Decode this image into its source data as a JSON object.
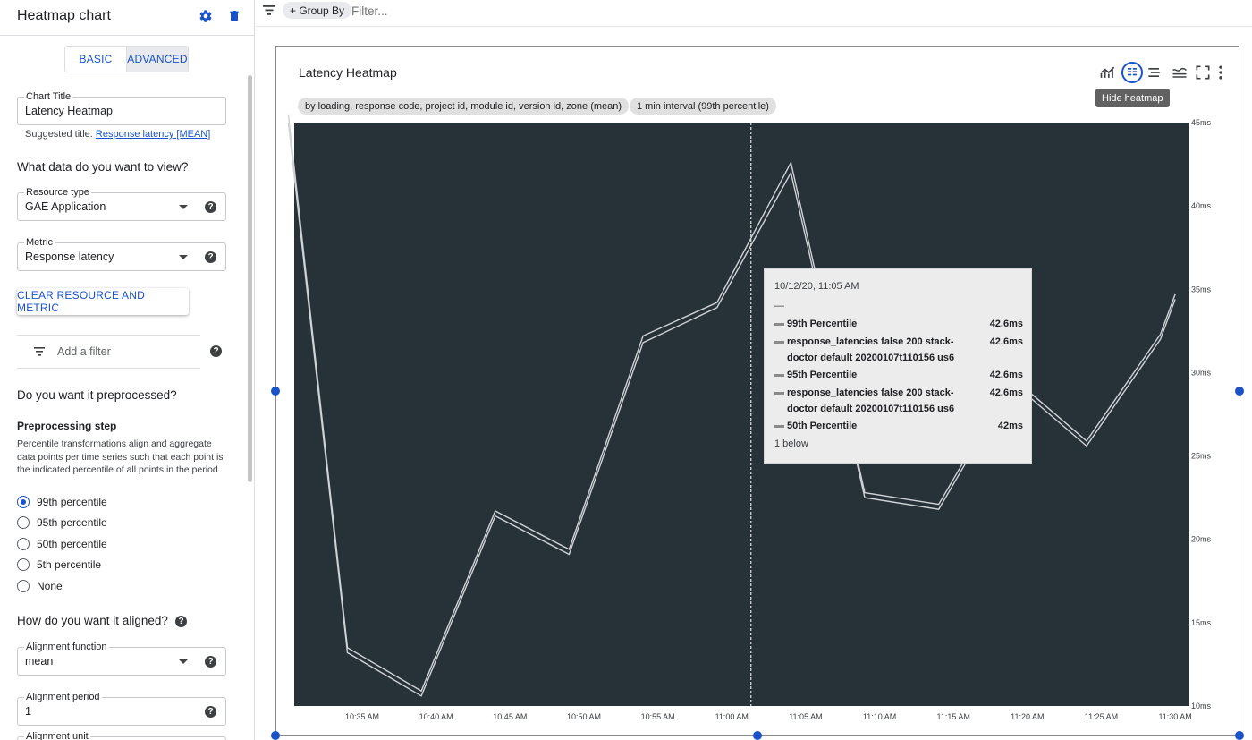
{
  "panel": {
    "title": "Heatmap chart",
    "modes": {
      "basic": "BASIC",
      "advanced": "ADVANCED",
      "active": "advanced"
    },
    "chart_title": {
      "label": "Chart Title",
      "value": "Latency Heatmap"
    },
    "suggested_prefix": "Suggested title:",
    "suggested_link": "Response latency [MEAN]",
    "data_heading": "What data do you want to view?",
    "resource_type": {
      "label": "Resource type",
      "value": "GAE Application"
    },
    "metric": {
      "label": "Metric",
      "value": "Response latency"
    },
    "clear_button": "CLEAR RESOURCE AND METRIC",
    "filter_placeholder": "Add a filter",
    "preprocess_heading": "Do you want it preprocessed?",
    "preprocess_step": "Preprocessing step",
    "preprocess_desc": "Percentile transformations align and aggregate data points per time series such that each point is the indicated percentile of all points in the period",
    "percentiles": [
      "99th percentile",
      "95th percentile",
      "50th percentile",
      "5th percentile",
      "None"
    ],
    "percentile_selected": "99th percentile",
    "align_heading": "How do you want it aligned?",
    "alignment_function": {
      "label": "Alignment function",
      "value": "mean"
    },
    "alignment_period": {
      "label": "Alignment period",
      "value": "1"
    },
    "alignment_unit_label": "Alignment unit"
  },
  "topbar": {
    "group_by": "+ Group By",
    "filter_placeholder": "Filter..."
  },
  "card": {
    "title": "Latency Heatmap",
    "hide_heatmap_tooltip": "Hide heatmap",
    "chips": [
      "by loading, response code, project id, module id, version id, zone (mean)",
      "1 min interval (99th percentile)"
    ],
    "icons": [
      "line-chart-icon",
      "heatmap-toggle-icon",
      "legend-icon",
      "compare-icon",
      "fullscreen-icon",
      "more-vert-icon"
    ]
  },
  "tooltip": {
    "date": "10/12/20, 11:05 AM",
    "dash": "—",
    "rows": [
      {
        "name": "99th Percentile",
        "value": "42.6ms"
      },
      {
        "name": "response_latencies false 200 stack-doctor default 20200107t110156 us6",
        "value": "42.6ms"
      },
      {
        "name": "95th Percentile",
        "value": "42.6ms"
      },
      {
        "name": "response_latencies false 200 stack-doctor default 20200107t110156 us6",
        "value": "42.6ms"
      },
      {
        "name": "50th Percentile",
        "value": "42ms"
      }
    ],
    "below": "1 below"
  },
  "colors": {
    "accent": "#1a53c9",
    "plot_bg": "#263238",
    "line": "#d0d2d6"
  },
  "chart_data": {
    "type": "line",
    "title": "Latency Heatmap",
    "x_ticks": [
      "10:35 AM",
      "10:40 AM",
      "10:45 AM",
      "10:50 AM",
      "10:55 AM",
      "11:00 AM",
      "11:05 AM",
      "11:10 AM",
      "11:15 AM",
      "11:20 AM",
      "11:25 AM",
      "11:30 AM"
    ],
    "y_ticks": [
      "45ms",
      "40ms",
      "35ms",
      "30ms",
      "25ms",
      "20ms",
      "15ms",
      "10ms"
    ],
    "ylim": [
      10,
      45
    ],
    "xlim_minutes": [
      30.4,
      90.9
    ],
    "x_origin": "10:00 AM",
    "cursor_x_minutes": 61.3,
    "series": [
      {
        "name": "99th Percentile",
        "points": [
          [
            "10:30 AM",
            45.5
          ],
          [
            "10:34 AM",
            13.5
          ],
          [
            "10:39 AM",
            10.9
          ],
          [
            "10:44 AM",
            21.7
          ],
          [
            "10:49 AM",
            19.4
          ],
          [
            "10:54 AM",
            32.2
          ],
          [
            "10:59 AM",
            34.2
          ],
          [
            "11:04 AM",
            42.6
          ],
          [
            "11:09 AM",
            22.8
          ],
          [
            "11:14 AM",
            22.1
          ],
          [
            "11:19 AM",
            29.7
          ],
          [
            "11:24 AM",
            25.9
          ],
          [
            "11:29 AM",
            32.3
          ],
          [
            "11:30 AM",
            34.7
          ]
        ]
      },
      {
        "name": "50th Percentile",
        "points": [
          [
            "10:30 AM",
            45.0
          ],
          [
            "10:34 AM",
            13.2
          ],
          [
            "10:39 AM",
            10.6
          ],
          [
            "10:44 AM",
            21.4
          ],
          [
            "10:49 AM",
            19.1
          ],
          [
            "10:54 AM",
            31.8
          ],
          [
            "10:59 AM",
            33.9
          ],
          [
            "11:04 AM",
            42.0
          ],
          [
            "11:09 AM",
            22.5
          ],
          [
            "11:14 AM",
            21.8
          ],
          [
            "11:19 AM",
            29.4
          ],
          [
            "11:24 AM",
            25.6
          ],
          [
            "11:29 AM",
            32.0
          ],
          [
            "11:30 AM",
            34.4
          ]
        ]
      }
    ]
  }
}
